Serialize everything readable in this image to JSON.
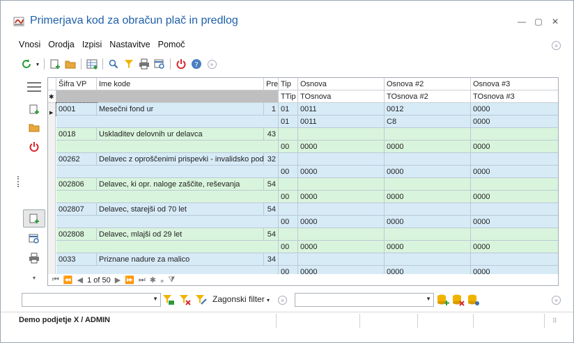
{
  "window": {
    "title": "Primerjava kod za obračun plač in predlog"
  },
  "menu": [
    "Vnosi",
    "Orodja",
    "Izpisi",
    "Nastavitve",
    "Pomoč"
  ],
  "grid": {
    "headers_top": [
      "Šifra VP",
      "Ime kode",
      "Pre",
      "Tip",
      "Osnova",
      "Osnova #2",
      "Osnova #3"
    ],
    "headers_sub": [
      "TTip",
      "TOsnova",
      "TOsnova #2",
      "TOsnova #3"
    ],
    "rows": [
      {
        "color": "blue",
        "sifra": "0001",
        "ime": "Mesečni fond ur",
        "pre": "1",
        "a": [
          "01",
          "0011",
          "0012",
          "0000"
        ],
        "b": [
          "01",
          "0011",
          "C8",
          "0000"
        ]
      },
      {
        "color": "green",
        "sifra": "0018",
        "ime": "Uskladitev delovnih ur delavca",
        "pre": "43",
        "a": [
          "",
          "",
          "",
          ""
        ],
        "b": [
          "00",
          "0000",
          "0000",
          "0000"
        ]
      },
      {
        "color": "blue",
        "sifra": "00262",
        "ime": "Delavec z oproščenimi prispevki - invalidsko podj.",
        "pre": "32",
        "a": [
          "",
          "",
          "",
          ""
        ],
        "b": [
          "00",
          "0000",
          "0000",
          "0000"
        ]
      },
      {
        "color": "green",
        "sifra": "002806",
        "ime": "Delavec, ki opr. naloge zaščite, reševanja",
        "pre": "54",
        "a": [
          "",
          "",
          "",
          ""
        ],
        "b": [
          "00",
          "0000",
          "0000",
          "0000"
        ]
      },
      {
        "color": "blue",
        "sifra": "002807",
        "ime": "Delavec, starejši od 70 let",
        "pre": "54",
        "a": [
          "",
          "",
          "",
          ""
        ],
        "b": [
          "00",
          "0000",
          "0000",
          "0000"
        ]
      },
      {
        "color": "green",
        "sifra": "002808",
        "ime": "Delavec, mlajši od 29 let",
        "pre": "54",
        "a": [
          "",
          "",
          "",
          ""
        ],
        "b": [
          "00",
          "0000",
          "0000",
          "0000"
        ]
      },
      {
        "color": "blue",
        "sifra": "0033",
        "ime": "Priznane nadure za malico",
        "pre": "34",
        "a": [
          "",
          "",
          "",
          ""
        ],
        "b": [
          "00",
          "0000",
          "0000",
          "0000"
        ]
      }
    ],
    "pager": "1 of 50"
  },
  "filter": {
    "label": "Zagonski filter"
  },
  "status": {
    "text": "Demo podjetje X / ADMIN"
  },
  "colors": {
    "blue_row": "#d7ebf7",
    "green_row": "#d9f4dc",
    "title": "#1e5fa8"
  }
}
